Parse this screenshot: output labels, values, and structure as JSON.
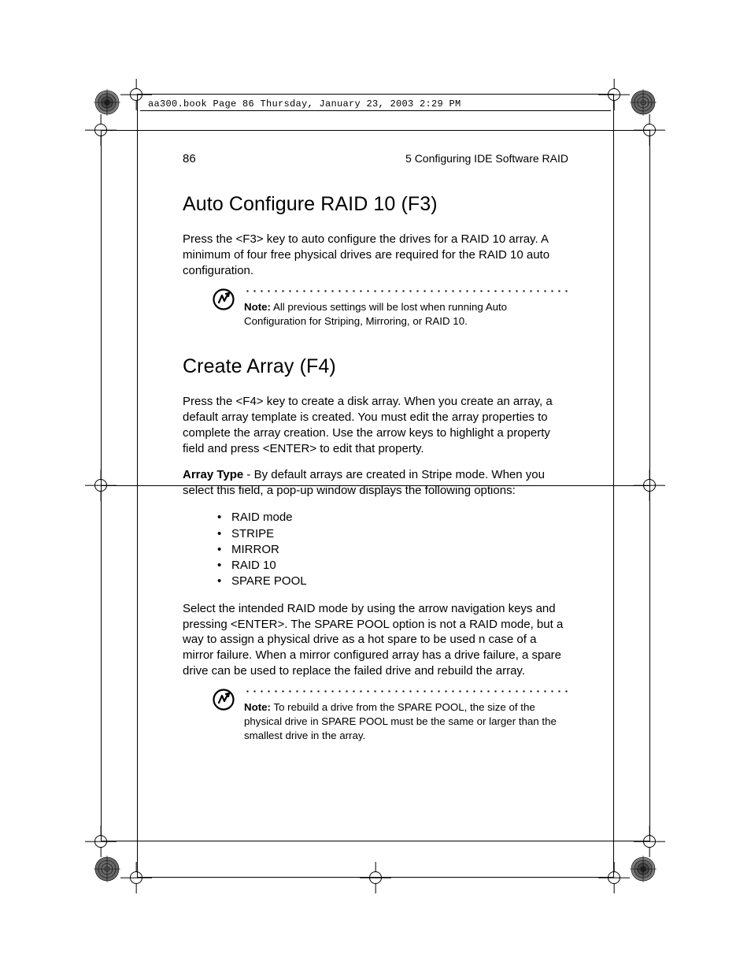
{
  "pageline": "aa300.book  Page 86  Thursday, January 23, 2003  2:29 PM",
  "runhead": {
    "pageno": "86",
    "section": "5 Configuring IDE Software RAID"
  },
  "h1": "Auto Configure RAID 10 (F3)",
  "p1": "Press the <F3> key to auto configure the drives for a RAID 10 array. A minimum of four free physical drives are required for the RAID 10 auto configuration.",
  "note1": {
    "label": "Note:",
    "text": " All previous settings will be lost when running Auto Configuration for Striping, Mirroring, or RAID 10."
  },
  "h2": "Create Array (F4)",
  "p2": "Press the <F4> key to create a disk array. When you create an array, a default array template is created. You must edit the array properties to complete the array creation. Use the arrow keys to highlight a property field and press <ENTER> to edit that property.",
  "p3": {
    "lead": "Array Type",
    "rest": " - By default arrays are created in Stripe mode. When you select this field, a pop-up window displays the following options:"
  },
  "bullets": [
    "RAID mode",
    "STRIPE",
    "MIRROR",
    "RAID 10",
    "SPARE POOL"
  ],
  "p4": "Select the intended RAID mode by using the arrow navigation keys and pressing <ENTER>. The SPARE POOL option is not a RAID mode, but a way to assign a physical drive as a hot spare to be used n case of a mirror failure. When a mirror configured array has a drive failure, a spare drive can be used to replace the failed drive and rebuild the array.",
  "note2": {
    "label": "Note:",
    "text": " To rebuild a drive from the SPARE POOL, the size of the physical drive in SPARE POOL must be the same or larger than the smallest drive in the array."
  }
}
